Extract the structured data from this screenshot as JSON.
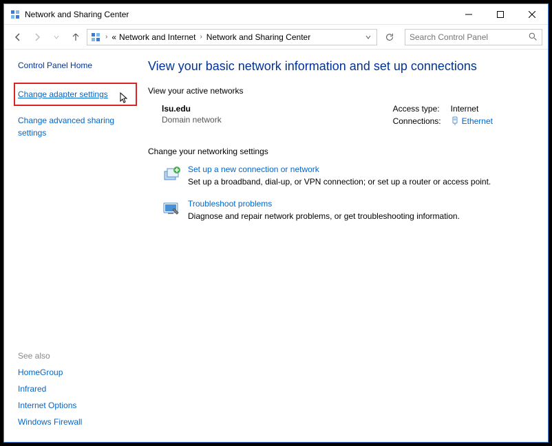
{
  "window": {
    "title": "Network and Sharing Center"
  },
  "breadcrumb": {
    "prefix": "«",
    "items": [
      "Network and Internet",
      "Network and Sharing Center"
    ]
  },
  "search": {
    "placeholder": "Search Control Panel"
  },
  "sidebar": {
    "home": "Control Panel Home",
    "link_adapter": "Change adapter settings",
    "link_advanced": "Change advanced sharing settings",
    "seealso_label": "See also",
    "seealso": [
      "HomeGroup",
      "Infrared",
      "Internet Options",
      "Windows Firewall"
    ]
  },
  "main": {
    "heading": "View your basic network information and set up connections",
    "active_h": "View your active networks",
    "network": {
      "name": "lsu.edu",
      "type": "Domain network",
      "access_label": "Access type:",
      "access_value": "Internet",
      "conn_label": "Connections:",
      "conn_value": "Ethernet"
    },
    "change_h": "Change your networking settings",
    "opt_new": {
      "title": "Set up a new connection or network",
      "desc": "Set up a broadband, dial-up, or VPN connection; or set up a router or access point."
    },
    "opt_trouble": {
      "title": "Troubleshoot problems",
      "desc": "Diagnose and repair network problems, or get troubleshooting information."
    }
  }
}
